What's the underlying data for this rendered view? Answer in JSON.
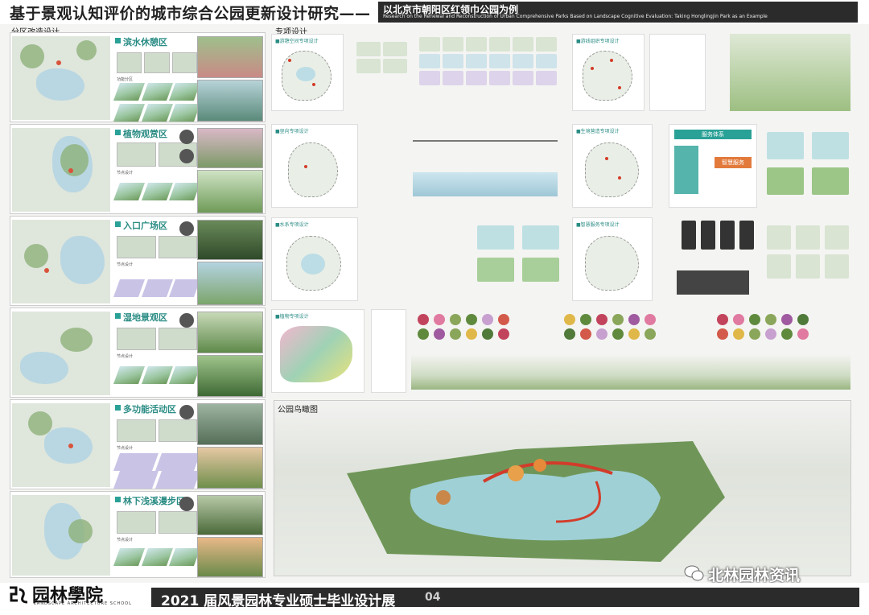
{
  "header": {
    "title": "基于景观认知评价的城市综合公园更新设计研究——",
    "subtitle_zh": "以北京市朝阳区红领巾公园为例",
    "subtitle_en": "Research on the Renewal and Reconstruction of Urban Comprehensive Parks Based on Landscape Cognitive Evaluation: Taking Honglingjin Park as an Example"
  },
  "left": {
    "section_label": "分区改造设计",
    "zones": [
      {
        "name": "滨水休憩区",
        "sub": "功能分区"
      },
      {
        "name": "植物观赏区",
        "sub": "节点设计"
      },
      {
        "name": "入口广场区",
        "sub": "节点设计"
      },
      {
        "name": "湿地景观区",
        "sub": "节点设计"
      },
      {
        "name": "多功能活动区",
        "sub": "节点设计"
      },
      {
        "name": "林下浅溪漫步区",
        "sub": "节点设计"
      }
    ]
  },
  "right": {
    "section_label": "专项设计",
    "aerial_label": "公园鸟瞰图",
    "card_tags": [
      "■游憩空间专项设计",
      "■游线组织专项设计",
      "■竖向专项设计",
      "■生境营造专项设计",
      "■水系专项设计",
      "■智慧服务专项设计",
      "■植物专项设计"
    ],
    "flow_box": "服务体系",
    "flow_center": "智慧服务"
  },
  "footer": {
    "school": "园林學院",
    "school_en": "LANDSCAPE ARCHITECTURE SCHOOL",
    "exhibition": "2021 届风景园林专业硕士毕业设计展",
    "page": "04"
  },
  "watermark": "北林园林资讯",
  "colors": {
    "accent": "#2aa197",
    "dark": "#2b2b2b",
    "route": "#d23c2a"
  }
}
